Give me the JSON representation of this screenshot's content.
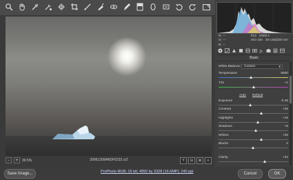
{
  "toolbar": {
    "icons": [
      "zoom-icon",
      "hand-icon",
      "white-balance-icon",
      "color-sampler-icon",
      "target-adjustment-icon",
      "crop-icon",
      "straighten-icon",
      "spot-removal-icon",
      "red-eye-icon",
      "adjustment-brush-icon",
      "graduated-filter-icon",
      "radial-filter-icon",
      "preferences-icon",
      "rotate-ccw-icon",
      "rotate-cw-icon"
    ],
    "export_icon": "fullscreen-icon"
  },
  "status": {
    "zoom": "30.5%",
    "zoom_minus": "-",
    "zoom_plus": "+",
    "filename": "20061209ANDF0232.cr2",
    "view_buttons": [
      "Y",
      "⊟",
      "⊠",
      "≡"
    ]
  },
  "footer": {
    "save_label": "Save Image...",
    "workflow_link": "ProPhoto RGB; 16 bit; 4992 by 3328 (16.6MP); 240 ppi",
    "cancel_label": "Cancel",
    "ok_label": "OK"
  },
  "info": {
    "rgb": [
      "R:",
      "G:",
      "B:"
    ],
    "rgb_values": [
      "---",
      "---",
      "---"
    ],
    "aperture": "f/13",
    "shutter": "1/500 s",
    "iso": "ISO 100",
    "lens": "28-135@28 mm"
  },
  "panel": {
    "title": "Basic",
    "white_balance_label": "White Balance:",
    "white_balance_value": "Custom",
    "auto_label": "Auto",
    "default_label": "Default",
    "sliders": [
      {
        "label": "Temperature",
        "value": "5650",
        "pos": 0.47
      },
      {
        "label": "Tint",
        "value": "+2",
        "pos": 0.51
      },
      {
        "label": "Exposure",
        "value": "-0.45",
        "pos": 0.46
      },
      {
        "label": "Contrast",
        "value": "+25",
        "pos": 0.62
      },
      {
        "label": "Highlights",
        "value": "+15",
        "pos": 0.57
      },
      {
        "label": "Shadows",
        "value": "+8",
        "pos": 0.54
      },
      {
        "label": "Whites",
        "value": "+25",
        "pos": 0.62
      },
      {
        "label": "Blacks",
        "value": "0",
        "pos": 0.5
      },
      {
        "label": "Clarity",
        "value": "+34",
        "pos": 0.67
      }
    ]
  },
  "colors": {
    "accent_ok": "#5a5a5a",
    "histogram_bg": "#222222"
  }
}
